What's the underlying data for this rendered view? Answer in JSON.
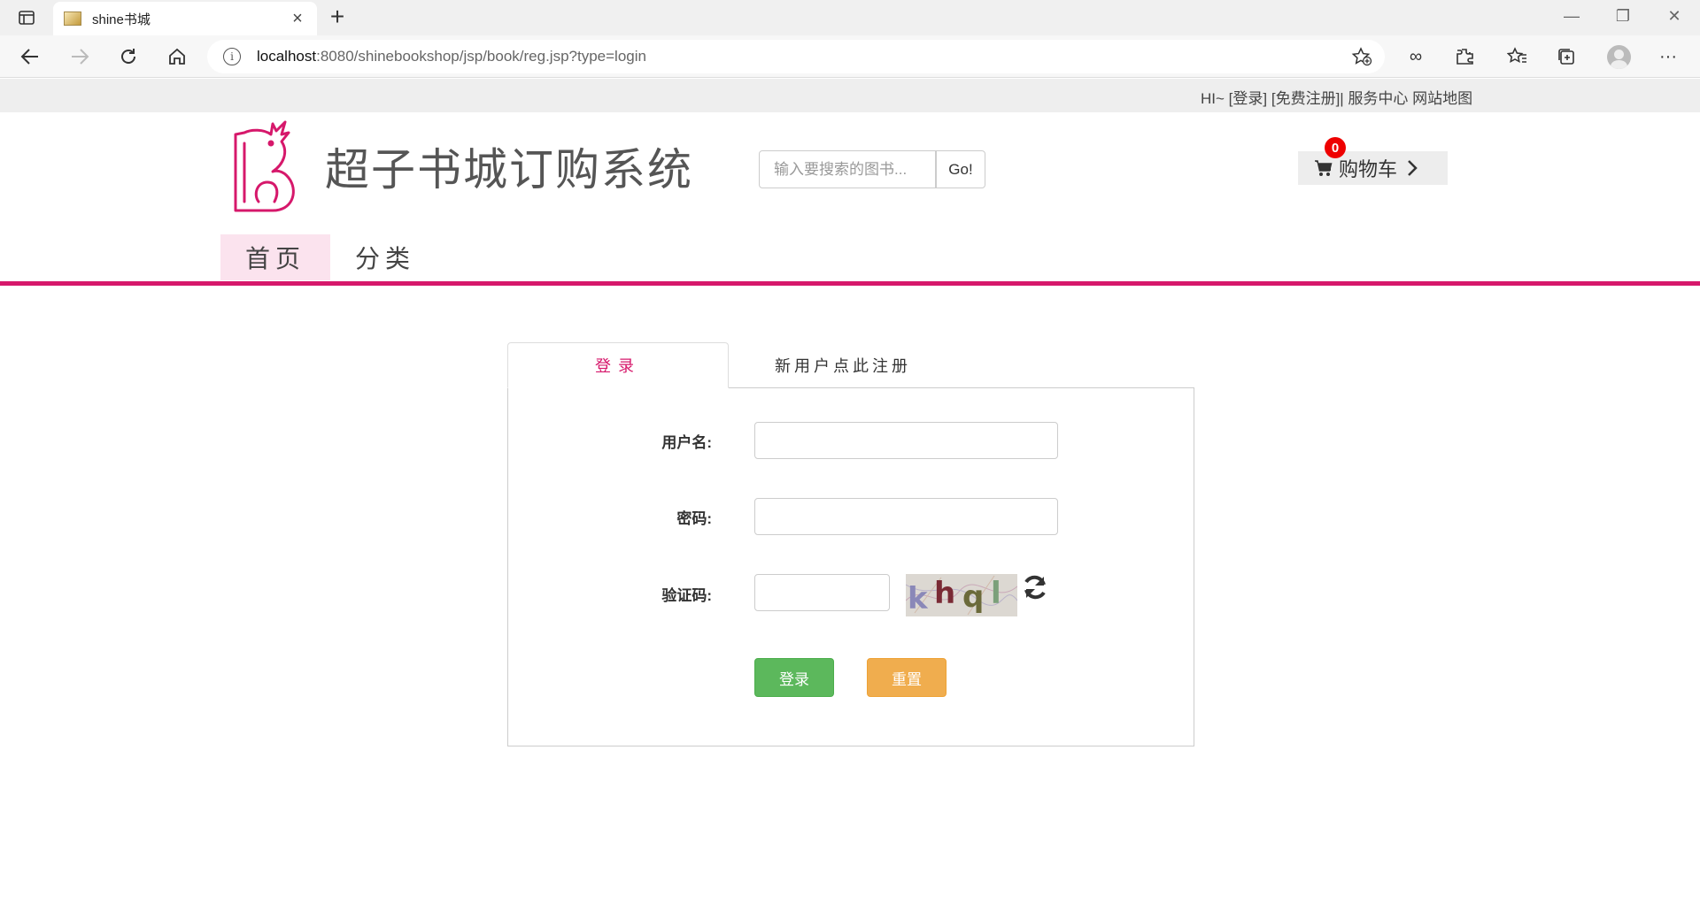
{
  "browser": {
    "tab_title": "shine书城",
    "url_host": "localhost",
    "url_rest": ":8080/shinebookshop/jsp/book/reg.jsp?type=login"
  },
  "topbar": {
    "greeting": "HI~ ",
    "login_link": "[登录]",
    "register_link": "[免费注册]",
    "separator": "| ",
    "service_center": "服务中心",
    "sitemap": "网站地图"
  },
  "header": {
    "site_title": "超子书城订购系统",
    "search_placeholder": "输入要搜索的图书...",
    "search_button": "Go!",
    "cart_label": "购物车",
    "cart_count": "0"
  },
  "nav": {
    "home": "首页",
    "category": "分类"
  },
  "login": {
    "tab_login": "登录",
    "tab_register": "新用户点此注册",
    "username_label": "用户名:",
    "password_label": "密码:",
    "captcha_label": "验证码:",
    "captcha_chars": [
      "k",
      "h",
      "q",
      "l"
    ],
    "login_button": "登录",
    "reset_button": "重置"
  },
  "colors": {
    "brand_pink": "#d6186b",
    "success_green": "#5cb85c",
    "warning_orange": "#f0ad4e",
    "badge_red": "#ee0000"
  }
}
